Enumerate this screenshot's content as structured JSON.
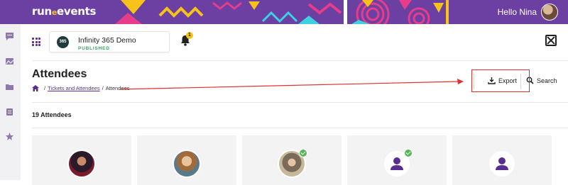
{
  "header": {
    "logo_main": "run",
    "logo_sep": "e",
    "logo_end": "events",
    "greeting": "Hello Nina"
  },
  "colors": {
    "brand_purple": "#6c3fa3",
    "accent_yellow": "#f7c21a",
    "published_green": "#3aa35a",
    "annotation_red": "#e0312f",
    "check_green": "#58b35a"
  },
  "sidebar": {
    "icons": [
      "chat-icon",
      "image-icon",
      "folder-icon",
      "clipboard-icon",
      "star-icon"
    ]
  },
  "event": {
    "badge": "365",
    "name": "Infinity 365 Demo",
    "status": "PUBLISHED"
  },
  "notifications": {
    "count": "1"
  },
  "page": {
    "title": "Attendees",
    "breadcrumb": {
      "link": "Tickets and Attendees",
      "separator": "/",
      "current": "Attendees"
    },
    "attendee_count": "19 Attendees"
  },
  "actions": {
    "export_label": "Export",
    "search_label": "Search"
  },
  "attendees": [
    {
      "avatar": "photo",
      "checked_in": false
    },
    {
      "avatar": "photo",
      "checked_in": false
    },
    {
      "avatar": "photo",
      "checked_in": true
    },
    {
      "avatar": "placeholder",
      "checked_in": true
    },
    {
      "avatar": "placeholder",
      "checked_in": false
    }
  ]
}
